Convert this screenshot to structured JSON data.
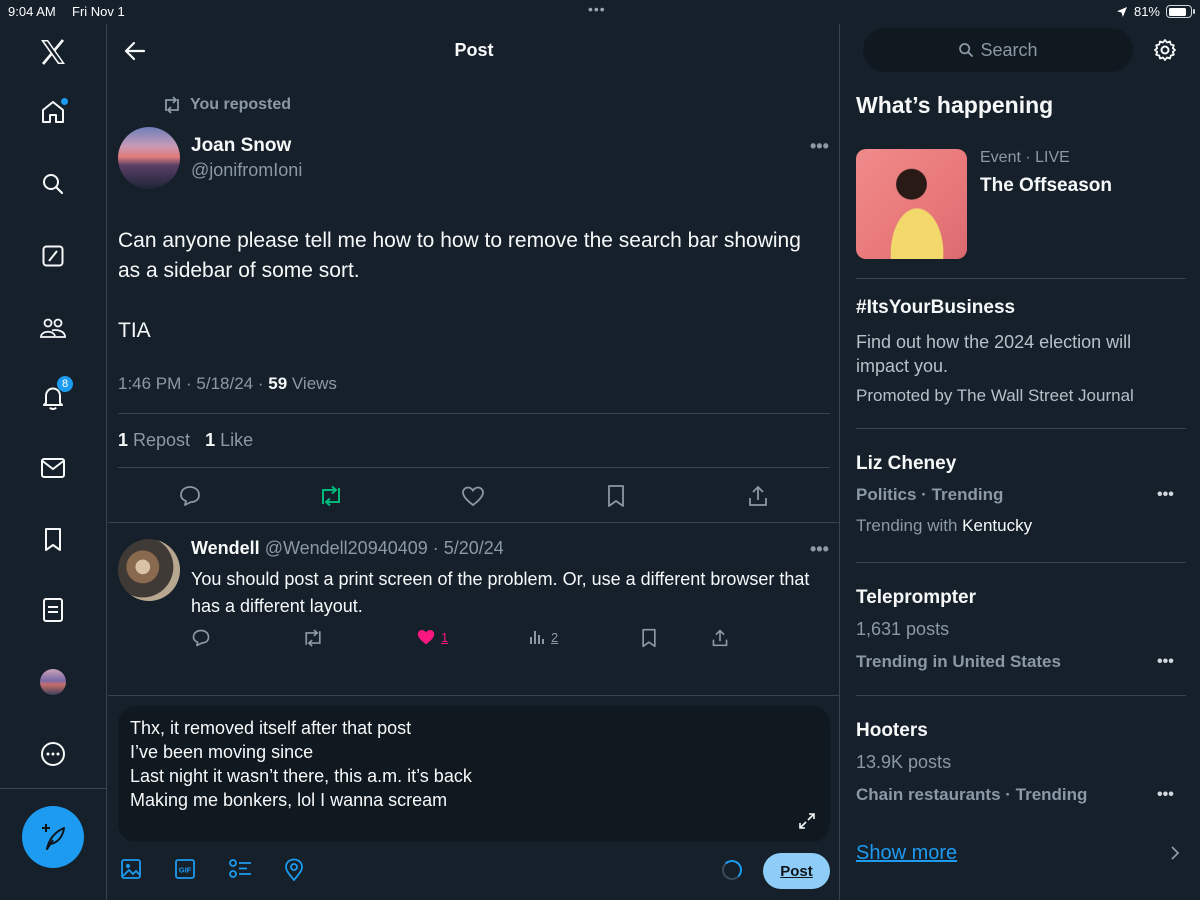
{
  "status_bar": {
    "time": "9:04 AM",
    "date": "Fri Nov 1",
    "dots": "•••",
    "battery": "81%",
    "battery_level": 0.81
  },
  "nav": {
    "items": [
      {
        "icon": "x-logo-icon"
      },
      {
        "icon": "home-icon",
        "has_dot": true
      },
      {
        "icon": "search-icon"
      },
      {
        "icon": "grok-icon"
      },
      {
        "icon": "communities-icon"
      },
      {
        "icon": "notifications-icon",
        "badge": "8"
      },
      {
        "icon": "messages-icon"
      },
      {
        "icon": "bookmarks-icon"
      },
      {
        "icon": "lists-icon"
      },
      {
        "icon": "profile-avatar"
      },
      {
        "icon": "more-icon"
      }
    ],
    "compose_icon": "compose-icon"
  },
  "header": {
    "title": "Post"
  },
  "tweet": {
    "repost_label": "You reposted",
    "author_name": "Joan Snow",
    "author_handle": "@jonifromIoni",
    "text_line1": "Can anyone please tell me how to how to remove the search bar showing as a sidebar of some sort.",
    "text_line2": "TIA",
    "time": "1:46 PM · 5/18/24 · ",
    "views_count": "59",
    "views_label": " Views",
    "repost_count": "1",
    "repost_label_stat": " Repost",
    "like_count": "1",
    "like_label_stat": " Like",
    "more": "•••"
  },
  "reply": {
    "name": "Wendell",
    "handle": " @Wendell20940409 · 5/20/24",
    "text": "You should post a print screen of the problem.  Or, use a different browser that has a different layout.",
    "like_count": "1",
    "views_count": "2",
    "more": "•••"
  },
  "compose": {
    "text": "Thx, it removed itself after that post\nI’ve been moving since\nLast night it wasn’t there, this a.m. it’s back\nMaking me bonkers, lol I wanna scream",
    "post_label": "Post"
  },
  "sidebar": {
    "search_placeholder": "Search",
    "whats_happening": "What’s happening",
    "event": {
      "kicker": "Event",
      "kicker_live": " · LIVE",
      "title": "The Offseason"
    },
    "trends": [
      {
        "title": "#ItsYourBusiness",
        "desc": "Find out how the 2024 election will impact you.",
        "promoted": "Promoted by The Wall Street Journal"
      },
      {
        "title": "Liz Cheney",
        "category": "Politics · Trending",
        "with_label": "Trending with ",
        "with_value": "Kentucky"
      },
      {
        "title": "Teleprompter",
        "posts": "1,631 posts",
        "category": "Trending in United States"
      },
      {
        "title": "Hooters",
        "posts": "13.9K posts",
        "category": "Chain restaurants · Trending"
      }
    ],
    "more": "•••",
    "show_more": "Show more"
  },
  "colors": {
    "background": "#15202b",
    "accent": "#1d9bf0",
    "repost_green": "#00ba7c",
    "like_pink": "#f91880"
  }
}
